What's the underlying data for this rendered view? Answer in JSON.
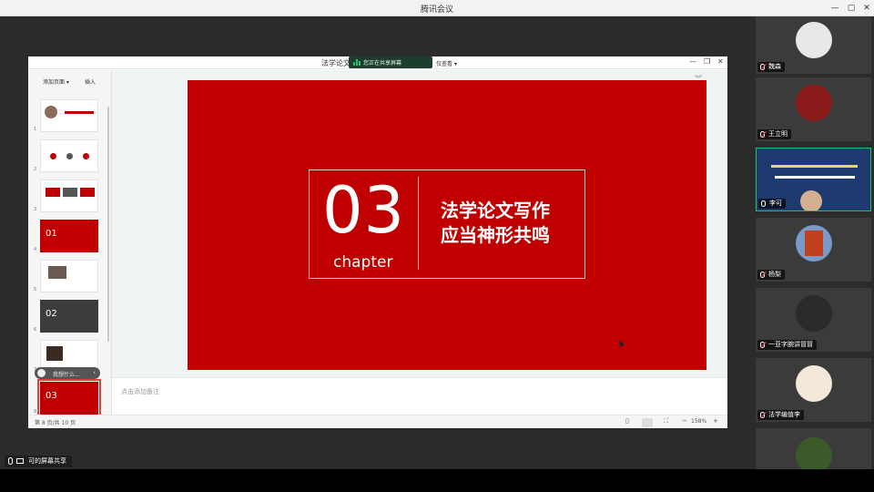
{
  "window": {
    "title": "腾讯会议"
  },
  "ppt": {
    "doc_title": "法学论文",
    "share_tag": "您正在共享屏幕",
    "view_only": "仅查看",
    "left_pane": {
      "add_page": "添加页面",
      "insert": "插入"
    },
    "thumbs": [
      {
        "num": "1",
        "style": "white"
      },
      {
        "num": "2",
        "style": "white"
      },
      {
        "num": "3",
        "style": "white"
      },
      {
        "num": "4",
        "style": "red",
        "label": "01"
      },
      {
        "num": "5",
        "style": "white"
      },
      {
        "num": "6",
        "style": "dark",
        "label": "02"
      },
      {
        "num": "7",
        "style": "white"
      },
      {
        "num": "8",
        "style": "red",
        "label": "03"
      }
    ],
    "tooltip": "我想什么...",
    "slide": {
      "number": "03",
      "chapter": "chapter",
      "heading_line1": "法学论文写作",
      "heading_line2": "应当神形共鸣"
    },
    "notes_placeholder": "点击添加备注",
    "status": {
      "page": "第 8 页/共 10 页",
      "zoom": "158%",
      "minus": "−",
      "plus": "+"
    }
  },
  "participants": [
    {
      "name": "魏森"
    },
    {
      "name": "王立明"
    },
    {
      "name": "李可"
    },
    {
      "name": "杨梨"
    },
    {
      "name": "一亚字腕讲冒冒"
    },
    {
      "name": "法学编值李"
    }
  ],
  "bottom": {
    "share_status": "可的屏幕共享"
  },
  "colors": {
    "slide_red": "#c00000",
    "accent_green": "#23c06a"
  }
}
